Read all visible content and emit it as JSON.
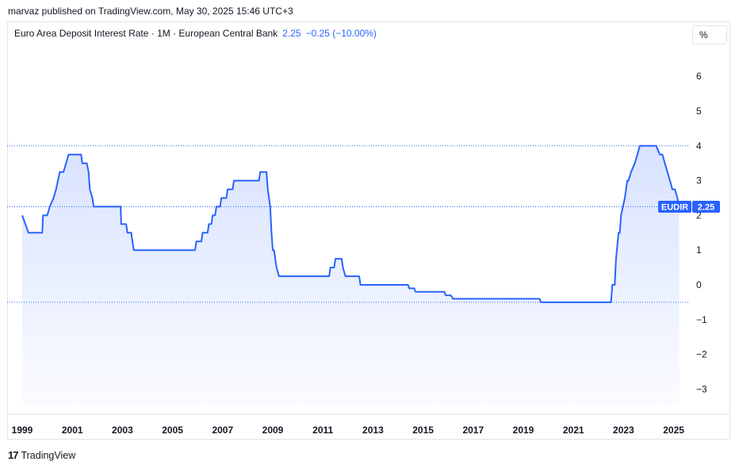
{
  "header": {
    "published_text": "marvaz published on TradingView.com, May 30, 2025 15:46 UTC+3"
  },
  "legend": {
    "title": "Euro Area Deposit Interest Rate · 1M · European Central Bank",
    "value": "2.25",
    "change": "−0.25 (−10.00%)"
  },
  "scale_button": {
    "label": "%"
  },
  "badge": {
    "symbol": "EUDIR",
    "value": "2.25"
  },
  "footer": {
    "brand_logo": "17",
    "brand_name": "TradingView"
  },
  "colors": {
    "line": "#2962ff",
    "fill": "#2962ff",
    "badge": "#2962ff",
    "text": "#131722",
    "grid": "#e0e3eb"
  },
  "chart_data": {
    "type": "area",
    "title": "Euro Area Deposit Interest Rate",
    "ylabel": "%",
    "ylim": [
      -3.6,
      6.6
    ],
    "y_ticks": [
      "6",
      "5",
      "4",
      "3",
      "2",
      "1",
      "0",
      "−1",
      "−2",
      "−3"
    ],
    "x_ticks": [
      "1999",
      "2001",
      "2003",
      "2005",
      "2007",
      "2009",
      "2011",
      "2013",
      "2015",
      "2017",
      "2019",
      "2021",
      "2023",
      "2025"
    ],
    "reference_lines": [
      4.0,
      2.25,
      -0.5
    ],
    "series": [
      {
        "name": "EUDIR",
        "points": [
          [
            1999.0,
            2.0
          ],
          [
            1999.25,
            1.5
          ],
          [
            1999.8,
            1.5
          ],
          [
            1999.83,
            2.0
          ],
          [
            2000.0,
            2.0
          ],
          [
            2000.1,
            2.25
          ],
          [
            2000.25,
            2.5
          ],
          [
            2000.35,
            2.75
          ],
          [
            2000.5,
            3.25
          ],
          [
            2000.65,
            3.25
          ],
          [
            2000.75,
            3.5
          ],
          [
            2000.85,
            3.75
          ],
          [
            2001.35,
            3.75
          ],
          [
            2001.4,
            3.5
          ],
          [
            2001.58,
            3.5
          ],
          [
            2001.65,
            3.25
          ],
          [
            2001.7,
            2.75
          ],
          [
            2001.8,
            2.5
          ],
          [
            2001.85,
            2.25
          ],
          [
            2002.93,
            2.25
          ],
          [
            2002.95,
            1.75
          ],
          [
            2003.15,
            1.75
          ],
          [
            2003.2,
            1.5
          ],
          [
            2003.35,
            1.5
          ],
          [
            2003.45,
            1.0
          ],
          [
            2005.9,
            1.0
          ],
          [
            2005.95,
            1.25
          ],
          [
            2006.15,
            1.25
          ],
          [
            2006.2,
            1.5
          ],
          [
            2006.4,
            1.5
          ],
          [
            2006.45,
            1.75
          ],
          [
            2006.55,
            1.75
          ],
          [
            2006.6,
            2.0
          ],
          [
            2006.7,
            2.0
          ],
          [
            2006.75,
            2.25
          ],
          [
            2006.9,
            2.25
          ],
          [
            2006.95,
            2.5
          ],
          [
            2007.15,
            2.5
          ],
          [
            2007.2,
            2.75
          ],
          [
            2007.4,
            2.75
          ],
          [
            2007.45,
            3.0
          ],
          [
            2008.45,
            3.0
          ],
          [
            2008.5,
            3.25
          ],
          [
            2008.75,
            3.25
          ],
          [
            2008.8,
            2.75
          ],
          [
            2008.9,
            2.25
          ],
          [
            2008.95,
            1.5
          ],
          [
            2009.0,
            1.0
          ],
          [
            2009.05,
            1.0
          ],
          [
            2009.15,
            0.5
          ],
          [
            2009.25,
            0.25
          ],
          [
            2011.25,
            0.25
          ],
          [
            2011.3,
            0.5
          ],
          [
            2011.45,
            0.5
          ],
          [
            2011.5,
            0.75
          ],
          [
            2011.75,
            0.75
          ],
          [
            2011.8,
            0.5
          ],
          [
            2011.9,
            0.25
          ],
          [
            2012.45,
            0.25
          ],
          [
            2012.5,
            0.0
          ],
          [
            2014.4,
            0.0
          ],
          [
            2014.45,
            -0.1
          ],
          [
            2014.65,
            -0.1
          ],
          [
            2014.7,
            -0.2
          ],
          [
            2015.85,
            -0.2
          ],
          [
            2015.9,
            -0.3
          ],
          [
            2016.1,
            -0.3
          ],
          [
            2016.2,
            -0.4
          ],
          [
            2019.65,
            -0.4
          ],
          [
            2019.7,
            -0.5
          ],
          [
            2022.5,
            -0.5
          ],
          [
            2022.55,
            0.0
          ],
          [
            2022.65,
            0.0
          ],
          [
            2022.7,
            0.75
          ],
          [
            2022.8,
            1.5
          ],
          [
            2022.85,
            1.5
          ],
          [
            2022.9,
            2.0
          ],
          [
            2023.05,
            2.5
          ],
          [
            2023.15,
            3.0
          ],
          [
            2023.2,
            3.0
          ],
          [
            2023.3,
            3.25
          ],
          [
            2023.45,
            3.5
          ],
          [
            2023.55,
            3.75
          ],
          [
            2023.65,
            4.0
          ],
          [
            2024.3,
            4.0
          ],
          [
            2024.45,
            3.75
          ],
          [
            2024.55,
            3.75
          ],
          [
            2024.65,
            3.5
          ],
          [
            2024.75,
            3.25
          ],
          [
            2024.85,
            3.0
          ],
          [
            2024.95,
            2.75
          ],
          [
            2025.05,
            2.75
          ],
          [
            2025.15,
            2.5
          ],
          [
            2025.22,
            2.25
          ]
        ]
      }
    ]
  }
}
